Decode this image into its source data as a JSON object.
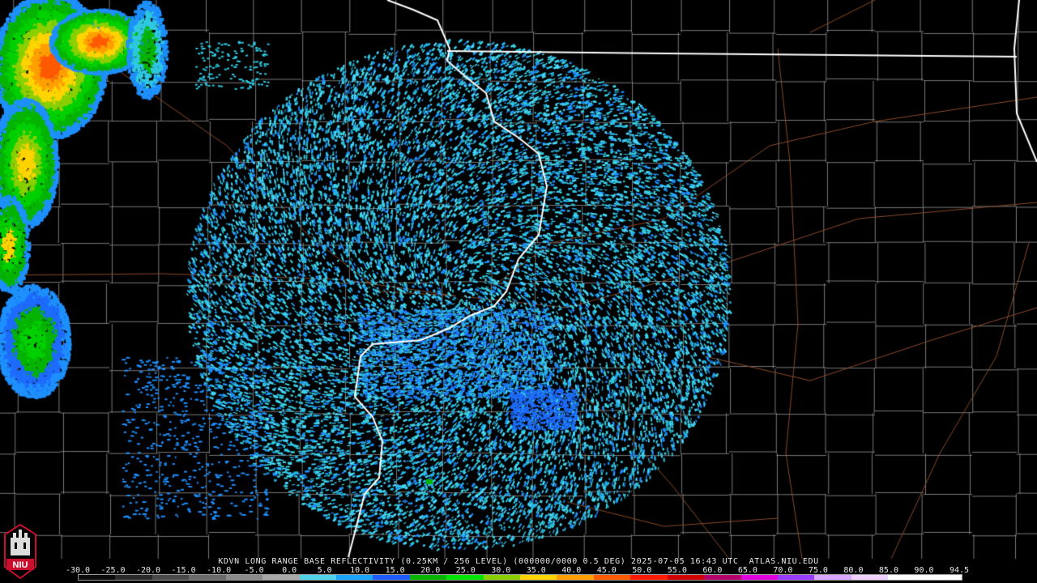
{
  "caption": "KDVN LONG RANGE BASE REFLECTIVITY (0.25KM / 256 LEVEL) (000000/0000 0.5 DEG) 2025-07-05 16:43 UTC  ATLAS.NIU.EDU",
  "scale": {
    "labels": [
      "-30.0",
      "-25.0",
      "-20.0",
      "-15.0",
      "-10.0",
      "-5.0",
      "0.0",
      "5.0",
      "10.0",
      "15.0",
      "20.0",
      "25.0",
      "30.0",
      "35.0",
      "40.0",
      "45.0",
      "50.0",
      "55.0",
      "60.0",
      "65.0",
      "70.0",
      "75.0",
      "80.0",
      "85.0",
      "90.0",
      "94.5"
    ],
    "colors": [
      "#0b0b0b",
      "#2a2a2a",
      "#4a4a4a",
      "#6a6a6a",
      "#8a8a8a",
      "#a9a9a9",
      "#4fd3e8",
      "#1aa6ff",
      "#1f5cff",
      "#06b400",
      "#00e600",
      "#8ad000",
      "#ffd400",
      "#ffa000",
      "#ff5a00",
      "#ff1a00",
      "#d00000",
      "#b4006a",
      "#e000e0",
      "#9a3cff",
      "#d9a6ff",
      "#f0d0ff",
      "#ffffff",
      "#ffffff"
    ]
  },
  "logo": {
    "text": "NIU",
    "icon": "niu-logo-icon"
  },
  "colors": {
    "background": "#000000",
    "county_lines": "#7a7a7a",
    "state_lines": "#ffffff",
    "highways": "#8a4a2a",
    "echo_light": "#2fc8e0",
    "echo_mid": "#1e90ff"
  }
}
